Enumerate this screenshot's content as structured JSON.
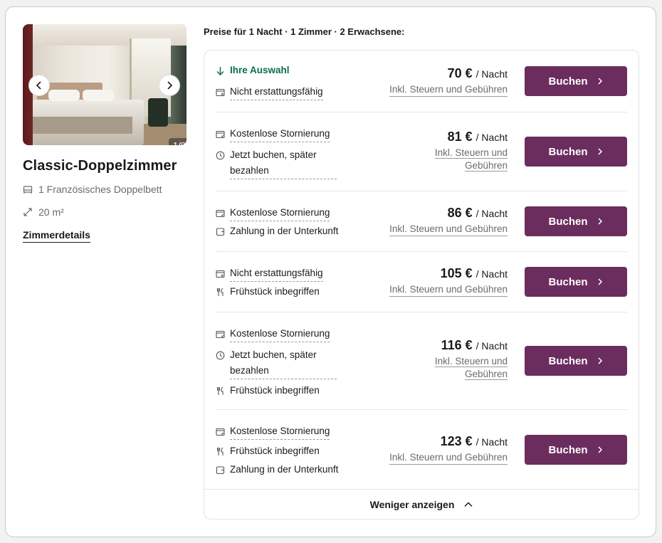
{
  "room": {
    "title": "Classic-Doppelzimmer",
    "bed": "1 Französisches Doppelbett",
    "size": "20 m²",
    "details_link": "Zimmerdetails",
    "photo_counter": "1/9"
  },
  "prices_heading": "Preise für 1 Nacht · 1 Zimmer · 2 Erwachsene:",
  "rates": [
    {
      "features": [
        {
          "icon": "arrow-down-icon",
          "text": "Ihre Auswahl"
        },
        {
          "icon": "calendar-x-icon",
          "text": "Nicht erstattungsfähig"
        }
      ],
      "price": "70 €",
      "per": "/ Nacht",
      "taxes": "Inkl. Steuern und Gebühren",
      "button": "Buchen"
    },
    {
      "features": [
        {
          "icon": "calendar-check-icon",
          "text": "Kostenlose Stornierung"
        },
        {
          "icon": "clock-icon",
          "text": "Jetzt buchen, später bezahlen"
        }
      ],
      "price": "81 €",
      "per": "/ Nacht",
      "taxes": "Inkl. Steuern und Gebühren",
      "button": "Buchen"
    },
    {
      "features": [
        {
          "icon": "calendar-check-icon",
          "text": "Kostenlose Stornierung"
        },
        {
          "icon": "wallet-icon",
          "text": "Zahlung in der Unterkunft"
        }
      ],
      "price": "86 €",
      "per": "/ Nacht",
      "taxes": "Inkl. Steuern und Gebühren",
      "button": "Buchen"
    },
    {
      "features": [
        {
          "icon": "calendar-x-icon",
          "text": "Nicht erstattungsfähig"
        },
        {
          "icon": "cutlery-icon",
          "text": "Frühstück inbegriffen"
        }
      ],
      "price": "105 €",
      "per": "/ Nacht",
      "taxes": "Inkl. Steuern und Gebühren",
      "button": "Buchen"
    },
    {
      "features": [
        {
          "icon": "calendar-check-icon",
          "text": "Kostenlose Stornierung"
        },
        {
          "icon": "clock-icon",
          "text": "Jetzt buchen, später bezahlen"
        },
        {
          "icon": "cutlery-icon",
          "text": "Frühstück inbegriffen"
        }
      ],
      "price": "116 €",
      "per": "/ Nacht",
      "taxes": "Inkl. Steuern und Gebühren",
      "button": "Buchen"
    },
    {
      "features": [
        {
          "icon": "calendar-check-icon",
          "text": "Kostenlose Stornierung"
        },
        {
          "icon": "cutlery-icon",
          "text": "Frühstück inbegriffen"
        },
        {
          "icon": "wallet-icon",
          "text": "Zahlung in der Unterkunft"
        }
      ],
      "price": "123 €",
      "per": "/ Nacht",
      "taxes": "Inkl. Steuern und Gebühren",
      "button": "Buchen"
    }
  ],
  "show_less": "Weniger anzeigen",
  "colors": {
    "button": "#6b2d5e",
    "selected": "#0b6e4f"
  }
}
